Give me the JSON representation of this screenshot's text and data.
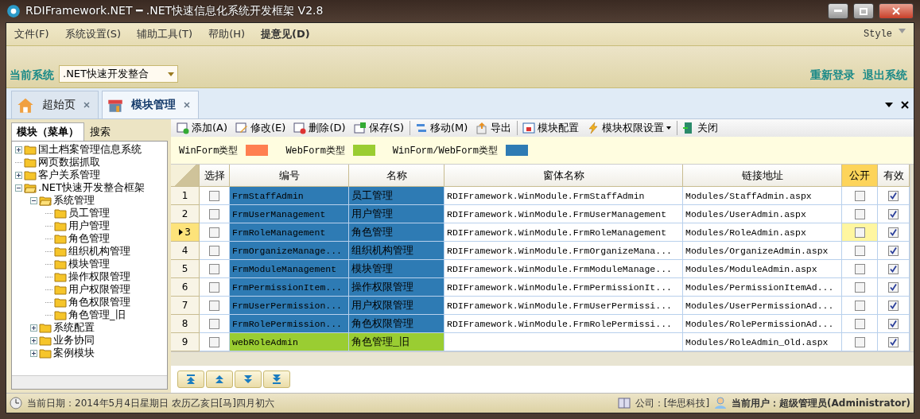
{
  "window": {
    "title": "RDIFramework.NET ━ .NET快速信息化系统开发框架 V2.8"
  },
  "menu": {
    "items": [
      {
        "label": "文件(F)",
        "emphasized": false
      },
      {
        "label": "系统设置(S)",
        "emphasized": false
      },
      {
        "label": "辅助工具(T)",
        "emphasized": false
      },
      {
        "label": "帮助(H)",
        "emphasized": false
      },
      {
        "label": "提意见(D)",
        "emphasized": true
      }
    ],
    "style_menu": "Style"
  },
  "system_bar": {
    "label": "当前系统",
    "value": ".NET快速开发整合",
    "links": [
      "重新登录",
      "退出系统"
    ]
  },
  "doc_tabs": [
    {
      "label": "超始页",
      "kind": "house",
      "selected": false
    },
    {
      "label": "模块管理",
      "kind": "shop",
      "selected": true
    }
  ],
  "left_panel": {
    "tabs": [
      {
        "label": "模块（菜单）",
        "selected": true
      },
      {
        "label": "搜索",
        "selected": false
      }
    ],
    "tree": [
      {
        "label": "国土档案管理信息系统",
        "expanded": false
      },
      {
        "label": "网页数据抓取"
      },
      {
        "label": "客户关系管理",
        "expanded": false
      },
      {
        "label": ".NET快速开发整合框架",
        "expanded": true,
        "children": [
          {
            "label": "系统管理",
            "expanded": true,
            "children": [
              {
                "label": "员工管理"
              },
              {
                "label": "用户管理"
              },
              {
                "label": "角色管理"
              },
              {
                "label": "组织机构管理"
              },
              {
                "label": "模块管理"
              },
              {
                "label": "操作权限管理"
              },
              {
                "label": "用户权限管理"
              },
              {
                "label": "角色权限管理"
              },
              {
                "label": "角色管理_旧"
              }
            ]
          },
          {
            "label": "系统配置",
            "expanded": false
          },
          {
            "label": "业务协同",
            "expanded": false
          },
          {
            "label": "案例模块",
            "expanded": false
          }
        ]
      }
    ]
  },
  "toolbar": [
    {
      "label": "添加(A)",
      "kind": "add",
      "separator_before": false,
      "dropdown": false
    },
    {
      "label": "修改(E)",
      "kind": "edit",
      "separator_before": false,
      "dropdown": false
    },
    {
      "label": "删除(D)",
      "kind": "delete",
      "separator_before": false,
      "dropdown": false
    },
    {
      "label": "保存(S)",
      "kind": "save",
      "separator_before": false,
      "dropdown": false
    },
    {
      "label": "移动(M)",
      "kind": "move",
      "separator_before": true,
      "dropdown": false
    },
    {
      "label": "导出",
      "kind": "export",
      "separator_before": false,
      "dropdown": false
    },
    {
      "label": "模块配置",
      "kind": "config",
      "separator_before": true,
      "dropdown": false
    },
    {
      "label": "模块权限设置",
      "kind": "bolt",
      "separator_before": false,
      "dropdown": true
    },
    {
      "label": "关闭",
      "kind": "exit",
      "separator_before": true,
      "dropdown": false
    }
  ],
  "legend": [
    {
      "label": "WinForm类型",
      "color": "#ff7f50"
    },
    {
      "label": "WebForm类型",
      "color": "#9acd32"
    },
    {
      "label": "WinForm/WebForm类型",
      "color": "#2e7bb4"
    }
  ],
  "table": {
    "columns": [
      {
        "label": "选择",
        "selected": false
      },
      {
        "label": "编号",
        "selected": false
      },
      {
        "label": "名称",
        "selected": false
      },
      {
        "label": "窗体名称",
        "selected": false
      },
      {
        "label": "链接地址",
        "selected": false
      },
      {
        "label": "公开",
        "selected": true
      },
      {
        "label": "有效",
        "selected": false
      }
    ],
    "rows": [
      {
        "index": "1",
        "checked": false,
        "code": "FrmStaffAdmin",
        "name": "员工管理",
        "form": "RDIFramework.WinModule.FrmStaffAdmin",
        "url": "Modules/StaffAdmin.aspx",
        "public": false,
        "valid": true,
        "color": "#2e7bb4",
        "selected": false
      },
      {
        "index": "2",
        "checked": false,
        "code": "FrmUserManagement",
        "name": "用户管理",
        "form": "RDIFramework.WinModule.FrmUserManagement",
        "url": "Modules/UserAdmin.aspx",
        "public": false,
        "valid": true,
        "color": "#2e7bb4",
        "selected": false
      },
      {
        "index": "3",
        "checked": false,
        "code": "FrmRoleManagement",
        "name": "角色管理",
        "form": "RDIFramework.WinModule.FrmRoleManagement",
        "url": "Modules/RoleAdmin.aspx",
        "public": false,
        "valid": true,
        "color": "#2e7bb4",
        "selected": true
      },
      {
        "index": "4",
        "checked": false,
        "code": "FrmOrganizeManage...",
        "name": "组织机构管理",
        "form": "RDIFramework.WinModule.FrmOrganizeMana...",
        "url": "Modules/OrganizeAdmin.aspx",
        "public": false,
        "valid": true,
        "color": "#2e7bb4",
        "selected": false
      },
      {
        "index": "5",
        "checked": false,
        "code": "FrmModuleManagement",
        "name": "模块管理",
        "form": "RDIFramework.WinModule.FrmModuleManage...",
        "url": "Modules/ModuleAdmin.aspx",
        "public": false,
        "valid": true,
        "color": "#2e7bb4",
        "selected": false
      },
      {
        "index": "6",
        "checked": false,
        "code": "FrmPermissionItem...",
        "name": "操作权限管理",
        "form": "RDIFramework.WinModule.FrmPermissionIt...",
        "url": "Modules/PermissionItemAd...",
        "public": false,
        "valid": true,
        "color": "#2e7bb4",
        "selected": false
      },
      {
        "index": "7",
        "checked": false,
        "code": "FrmUserPermission...",
        "name": "用户权限管理",
        "form": "RDIFramework.WinModule.FrmUserPermissi...",
        "url": "Modules/UserPermissionAd...",
        "public": false,
        "valid": true,
        "color": "#2e7bb4",
        "selected": false
      },
      {
        "index": "8",
        "checked": false,
        "code": "FrmRolePermission...",
        "name": "角色权限管理",
        "form": "RDIFramework.WinModule.FrmRolePermissi...",
        "url": "Modules/RolePermissionAd...",
        "public": false,
        "valid": true,
        "color": "#2e7bb4",
        "selected": false
      },
      {
        "index": "9",
        "checked": false,
        "code": "webRoleAdmin",
        "name": "角色管理_旧",
        "url": "Modules/RoleAdmin_Old.aspx",
        "public": false,
        "valid": true,
        "color": "#9acd32",
        "selected": false
      }
    ]
  },
  "nav_buttons": [
    {
      "kind": "first"
    },
    {
      "kind": "prev"
    },
    {
      "kind": "next"
    },
    {
      "kind": "last"
    }
  ],
  "status_bar": {
    "date": "当前日期：2014年5月4日星期日 农历乙亥日[马]四月初六",
    "company": "公司：[华思科技]",
    "user": "当前用户：超级管理员(Administrator)"
  }
}
